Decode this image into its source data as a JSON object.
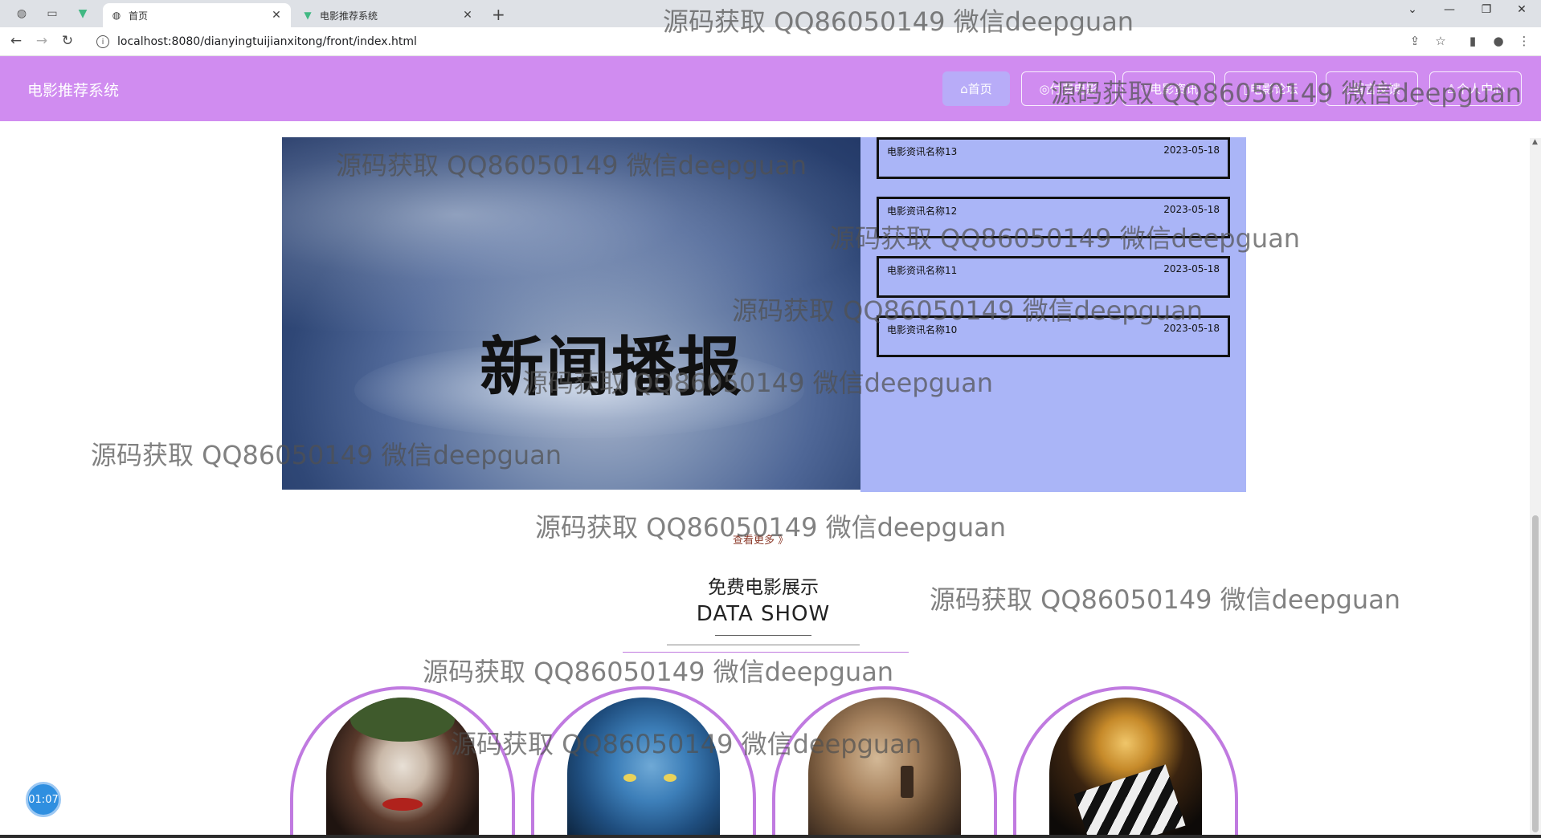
{
  "browser": {
    "tabs": [
      {
        "title": "首页"
      },
      {
        "title": "电影推荐系统"
      }
    ],
    "address": "localhost:8080/dianyingtuijianxitong/front/index.html"
  },
  "site": {
    "brand": "电影推荐系统",
    "nav": [
      {
        "label": "⌂首页"
      },
      {
        "label": "◎付费电影"
      },
      {
        "label": "♢电影资讯"
      },
      {
        "label": "▯电影论坛"
      },
      {
        "label": "◇留言反馈"
      },
      {
        "label": "♙个人中心"
      }
    ]
  },
  "news": {
    "banner_text": "新闻播报",
    "items": [
      {
        "name": "电影资讯名称13",
        "date": "2023-05-18"
      },
      {
        "name": "电影资讯名称12",
        "date": "2023-05-18"
      },
      {
        "name": "电影资讯名称11",
        "date": "2023-05-18"
      },
      {
        "name": "电影资讯名称10",
        "date": "2023-05-18"
      }
    ],
    "more": "查看更多 》"
  },
  "section": {
    "title_cn": "免费电影展示",
    "title_en": "DATA SHOW"
  },
  "watermark": "源码获取 QQ86050149 微信deepguan",
  "timer": "01:07"
}
